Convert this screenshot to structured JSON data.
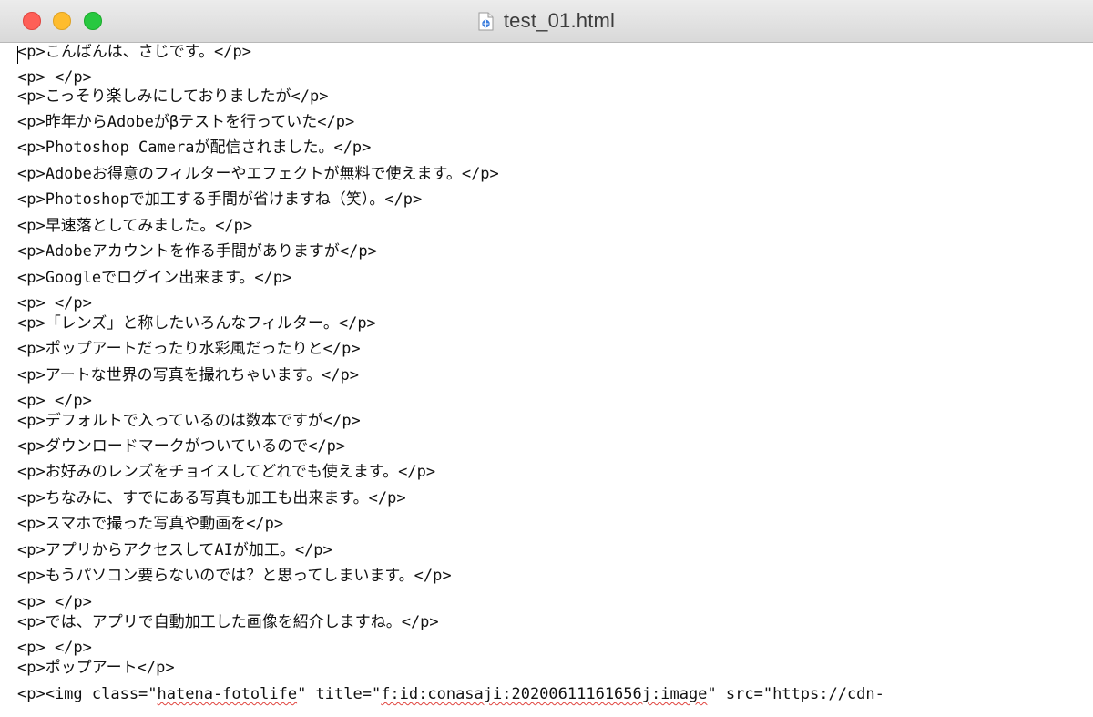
{
  "window": {
    "title": "test_01.html",
    "file_icon": "html-document-icon"
  },
  "editor": {
    "lines": [
      "<p>こんばんは、さじです。</p>",
      "<p> </p>",
      "<p>こっそり楽しみにしておりましたが</p>",
      "<p>昨年からAdobeがβテストを行っていた</p>",
      "<p>Photoshop Cameraが配信されました。</p>",
      "<p>Adobeお得意のフィルターやエフェクトが無料で使えます。</p>",
      "<p>Photoshopで加工する手間が省けますね（笑）。</p>",
      "<p>早速落としてみました。</p>",
      "<p>Adobeアカウントを作る手間がありますが</p>",
      "<p>Googleでログイン出来ます。</p>",
      "<p> </p>",
      "<p>「レンズ」と称したいろんなフィルター。</p>",
      "<p>ポップアートだったり水彩風だったりと</p>",
      "<p>アートな世界の写真を撮れちゃいます。</p>",
      "<p> </p>",
      "<p>デフォルトで入っているのは数本ですが</p>",
      "<p>ダウンロードマークがついているので</p>",
      "<p>お好みのレンズをチョイスしてどれでも使えます。</p>",
      "<p>ちなみに、すでにある写真も加工も出来ます。</p>",
      "<p>スマホで撮った写真や動画を</p>",
      "<p>アプリからアクセスしてAIが加工。</p>",
      "<p>もうパソコン要らないのでは？と思ってしまいます。</p>",
      "<p> </p>",
      "<p>では、アプリで自動加工した画像を紹介しますね。</p>",
      "<p> </p>",
      "<p>ポップアート</p>"
    ],
    "img_line": {
      "part1": "<p><img class=\"",
      "class_value": "hatena-fotolife",
      "part2": "\" title=\"",
      "title_value": "f:id:conasaji:20200611161656j:image",
      "part3": "\" src=\"https://cdn-"
    }
  }
}
